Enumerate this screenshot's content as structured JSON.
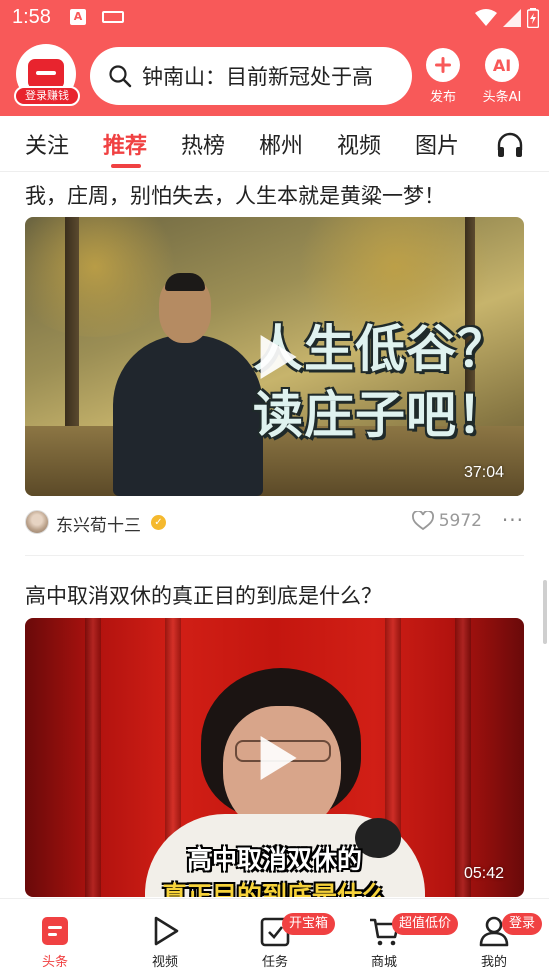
{
  "status_bar": {
    "time": "1:58",
    "app_icon_letter": "A"
  },
  "header": {
    "login_badge": "登录赚钱",
    "search_query": "钟南山：目前新冠处于高",
    "publish_label": "发布",
    "ai_label": "头条AI",
    "ai_icon_text": "AI",
    "brand_color": "#f85959"
  },
  "tabs": {
    "items": [
      "关注",
      "推荐",
      "热榜",
      "郴州",
      "视频",
      "图片"
    ],
    "active": "推荐",
    "active_color": "#f04142"
  },
  "feed": {
    "posts": [
      {
        "title": "我，庄周，别怕失去，人生本就是黄粱一梦！",
        "thumbnail_text_line1": "人生低谷？",
        "thumbnail_text_line2": "读庄子吧！",
        "duration": "37:04",
        "author": "东兴荀十三",
        "likes": "5972"
      },
      {
        "title": "高中取消双休的真正目的到底是什么？",
        "subtitle_line1": "高中取消双休的",
        "subtitle_line2": "真正目的到底是什么",
        "duration": "05:42"
      }
    ]
  },
  "bottom_nav": {
    "items": [
      {
        "label": "头条",
        "icon": "home-icon"
      },
      {
        "label": "视频",
        "icon": "play-icon"
      },
      {
        "label": "任务",
        "icon": "task-icon",
        "badge": "开宝箱"
      },
      {
        "label": "商城",
        "icon": "cart-icon",
        "badge": "超值低价"
      },
      {
        "label": "我的",
        "icon": "user-icon",
        "badge": "登录"
      }
    ],
    "active": "头条"
  }
}
